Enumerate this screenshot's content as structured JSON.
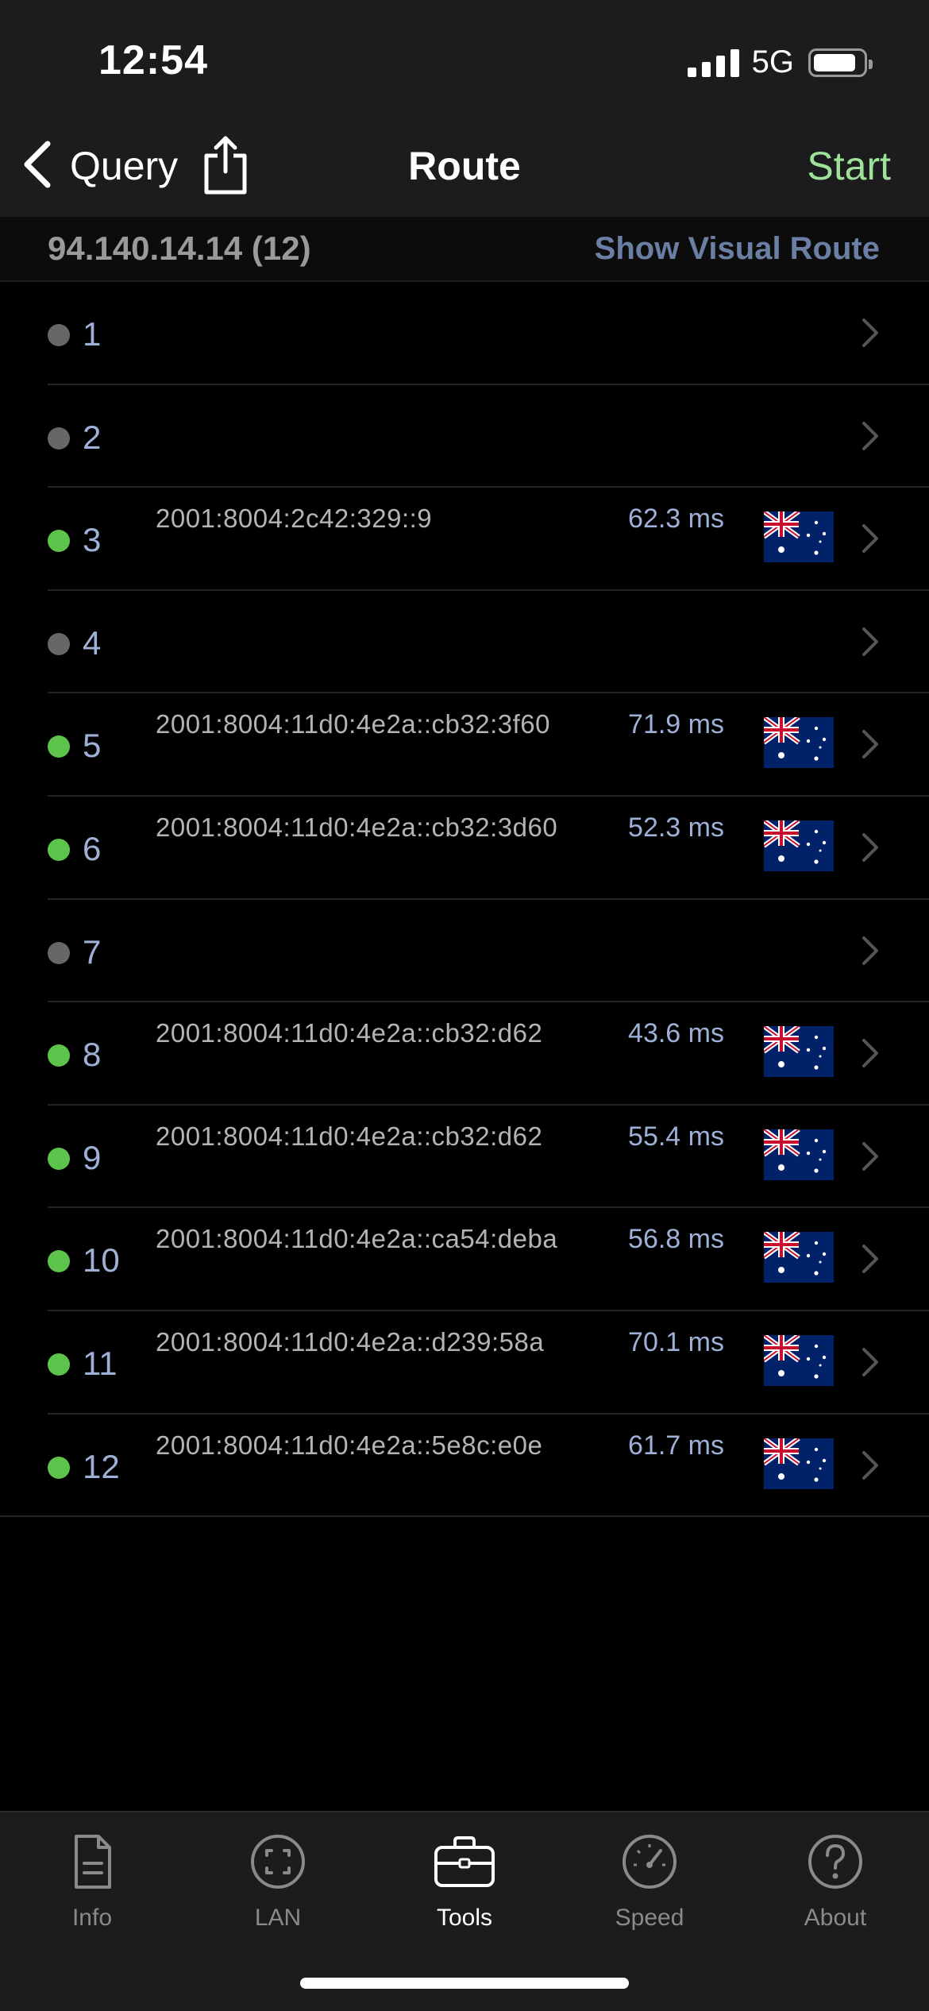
{
  "status": {
    "time": "12:54",
    "network": "5G"
  },
  "nav": {
    "back_label": "Query",
    "title": "Route",
    "start_label": "Start"
  },
  "route": {
    "target": "94.140.14.14 (12)",
    "visual_link": "Show Visual Route"
  },
  "hops": [
    {
      "num": "1",
      "active": false,
      "ip": "",
      "ms": "",
      "flag": ""
    },
    {
      "num": "2",
      "active": false,
      "ip": "",
      "ms": "",
      "flag": ""
    },
    {
      "num": "3",
      "active": true,
      "ip": "2001:8004:2c42:329::9",
      "ms": "62.3 ms",
      "flag": "australia-flag"
    },
    {
      "num": "4",
      "active": false,
      "ip": "",
      "ms": "",
      "flag": ""
    },
    {
      "num": "5",
      "active": true,
      "ip": "2001:8004:11d0:4e2a::cb32:3f60",
      "ms": "71.9 ms",
      "flag": "australia-flag"
    },
    {
      "num": "6",
      "active": true,
      "ip": "2001:8004:11d0:4e2a::cb32:3d60",
      "ms": "52.3 ms",
      "flag": "australia-flag"
    },
    {
      "num": "7",
      "active": false,
      "ip": "",
      "ms": "",
      "flag": ""
    },
    {
      "num": "8",
      "active": true,
      "ip": "2001:8004:11d0:4e2a::cb32:d62",
      "ms": "43.6 ms",
      "flag": "australia-flag"
    },
    {
      "num": "9",
      "active": true,
      "ip": "2001:8004:11d0:4e2a::cb32:d62",
      "ms": "55.4 ms",
      "flag": "australia-flag"
    },
    {
      "num": "10",
      "active": true,
      "ip": "2001:8004:11d0:4e2a::ca54:deba",
      "ms": "56.8 ms",
      "flag": "australia-flag"
    },
    {
      "num": "11",
      "active": true,
      "ip": "2001:8004:11d0:4e2a::d239:58a",
      "ms": "70.1 ms",
      "flag": "australia-flag"
    },
    {
      "num": "12",
      "active": true,
      "ip": "2001:8004:11d0:4e2a::5e8c:e0e",
      "ms": "61.7 ms",
      "flag": "australia-flag"
    }
  ],
  "tabs": [
    {
      "label": "Info",
      "icon": "document-icon",
      "active": false
    },
    {
      "label": "LAN",
      "icon": "scan-icon",
      "active": false
    },
    {
      "label": "Tools",
      "icon": "toolbox-icon",
      "active": true
    },
    {
      "label": "Speed",
      "icon": "speedometer-icon",
      "active": false
    },
    {
      "label": "About",
      "icon": "question-icon",
      "active": false
    }
  ],
  "colors": {
    "accent_start": "#9ee29a",
    "link": "#6b7fa5",
    "hop_active": "#5cc44a",
    "hop_inactive": "#676767",
    "hop_number": "#9eb0d6"
  }
}
